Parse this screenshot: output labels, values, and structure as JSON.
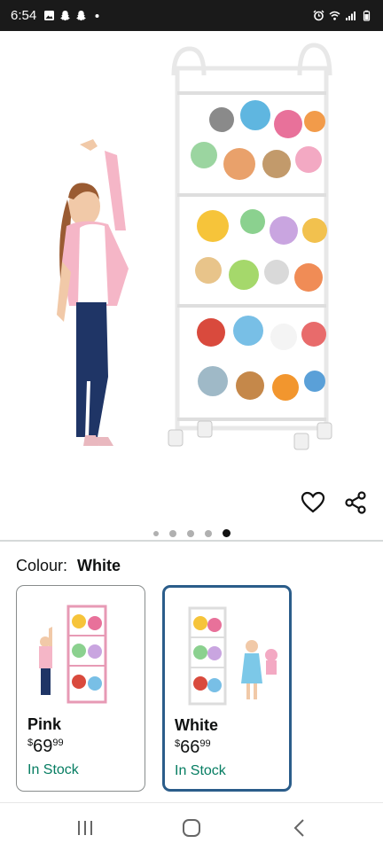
{
  "status_bar": {
    "time": "6:54",
    "left_icons": [
      "gallery-icon",
      "snapchat-icon",
      "snapchat-icon",
      "dot-icon"
    ],
    "right_icons": [
      "alarm-icon",
      "wifi-icon",
      "signal-icon",
      "battery-icon"
    ]
  },
  "product": {
    "image_description_icon": "toy-storage-cart-icon",
    "carousel": {
      "count": 5,
      "active_index": 4
    }
  },
  "actions": {
    "wishlist_icon": "heart-icon",
    "share_icon": "share-icon"
  },
  "variation": {
    "label": "Colour:",
    "selected": "White",
    "options": [
      {
        "name": "Pink",
        "currency": "$",
        "price_whole": "69",
        "price_fraction": "99",
        "stock": "In Stock",
        "selected": false,
        "frame_color": "#e79ab5"
      },
      {
        "name": "White",
        "currency": "$",
        "price_whole": "66",
        "price_fraction": "99",
        "stock": "In Stock",
        "selected": true,
        "frame_color": "#f2f2f2"
      }
    ]
  },
  "nav": {
    "recents_icon": "recents-icon",
    "home_icon": "home-icon",
    "back_icon": "back-icon"
  },
  "colors": {
    "status_bar": "#1a1a1a",
    "selected_border": "#2b5d8a",
    "in_stock": "#067d62",
    "divider": "#d5d9d9"
  }
}
